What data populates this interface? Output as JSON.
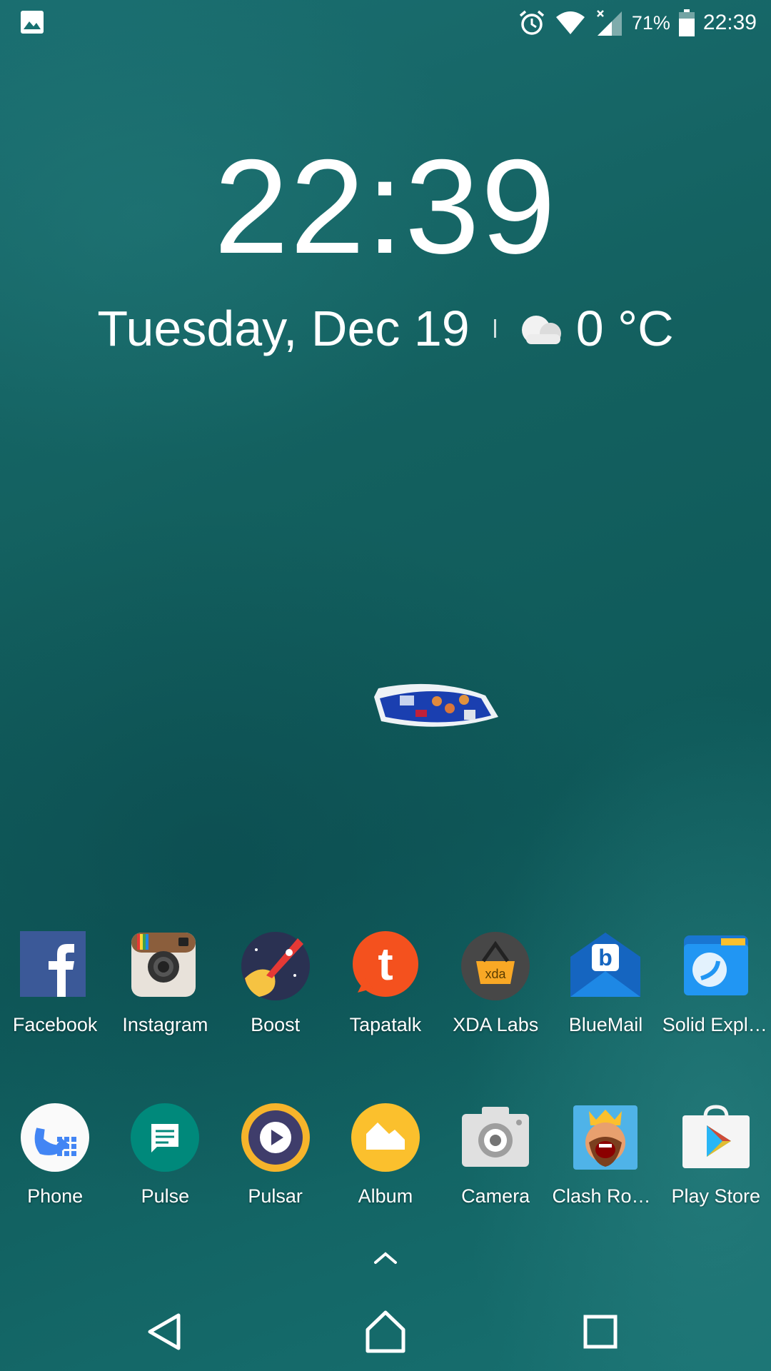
{
  "status_bar": {
    "battery_percent": "71%",
    "time": "22:39",
    "icons": [
      "image-icon",
      "alarm-icon",
      "wifi-icon",
      "signal-icon",
      "battery-icon"
    ]
  },
  "clock_widget": {
    "time": "22:39",
    "date": "Tuesday, Dec 19",
    "temperature": "0 °C",
    "weather_icon": "cloud-icon"
  },
  "apps_row1": [
    {
      "label": "Facebook"
    },
    {
      "label": "Instagram"
    },
    {
      "label": "Boost"
    },
    {
      "label": "Tapatalk"
    },
    {
      "label": "XDA Labs"
    },
    {
      "label": "BlueMail"
    },
    {
      "label": "Solid Explo..."
    }
  ],
  "apps_row2": [
    {
      "label": "Phone"
    },
    {
      "label": "Pulse"
    },
    {
      "label": "Pulsar"
    },
    {
      "label": "Album"
    },
    {
      "label": "Camera"
    },
    {
      "label": "Clash Roya..."
    },
    {
      "label": "Play Store"
    }
  ],
  "colors": {
    "facebook": "#3b5998",
    "tapatalk": "#f4511e",
    "bluemail": "#1565c0",
    "pulse": "#00897b",
    "album": "#fbc02d",
    "pulsar": "#3f3d6b"
  },
  "navigation": [
    "back-icon",
    "home-icon",
    "recents-icon"
  ]
}
